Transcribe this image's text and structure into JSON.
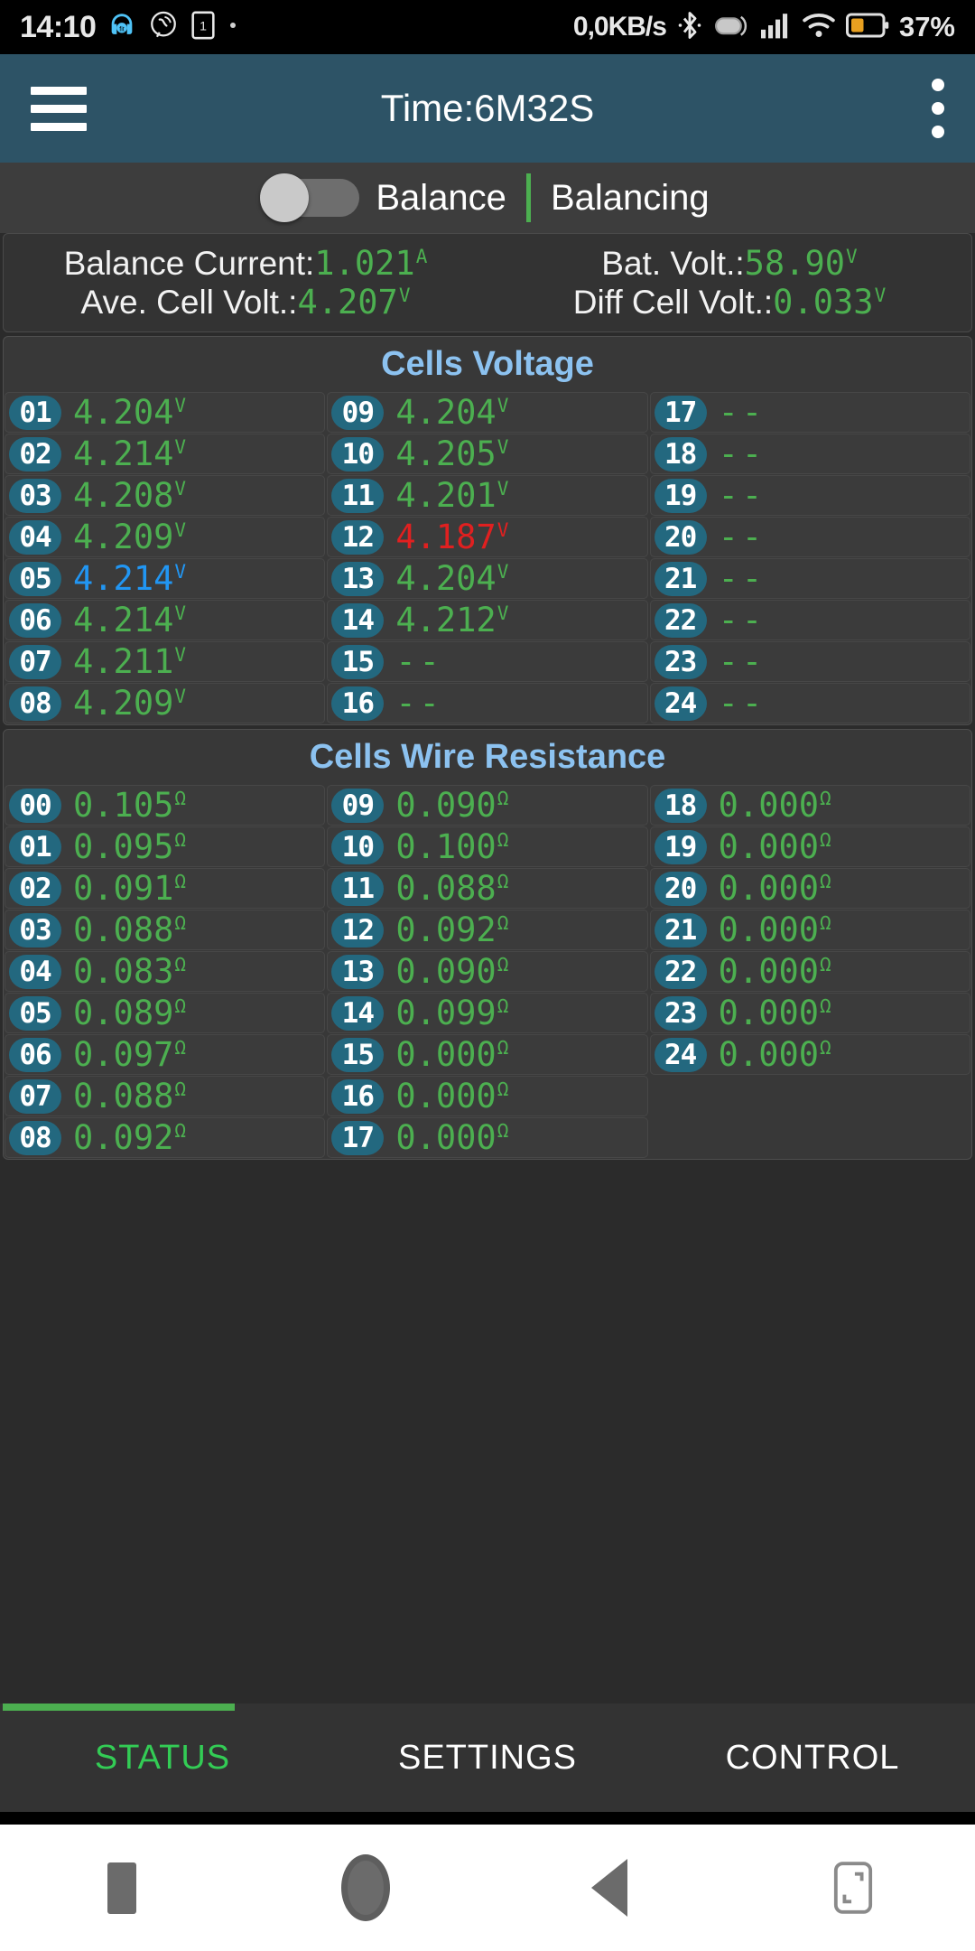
{
  "statusbar": {
    "clock": "14:10",
    "network_speed": "0,0KB/s",
    "battery_percent": "37%",
    "icons": [
      "headphones-icon",
      "viber-icon",
      "sim-card-icon",
      "dot-icon",
      "bluetooth-icon",
      "data-saver-icon",
      "signal-icon",
      "wifi-icon",
      "battery-icon"
    ]
  },
  "appbar": {
    "menu_icon": "hamburger-menu-icon",
    "title": "Time:6M32S",
    "overflow_icon": "kebab-menu-icon"
  },
  "balance_row": {
    "toggle_state": "off",
    "toggle_label": "Balance",
    "status_label": "Balancing"
  },
  "summary": {
    "balance_current": {
      "label": "Balance Current:",
      "value": "1.021",
      "unit": "A"
    },
    "bat_volt": {
      "label": "Bat. Volt.:",
      "value": "58.90",
      "unit": "V"
    },
    "ave_cell_volt": {
      "label": "Ave. Cell Volt.:",
      "value": "4.207",
      "unit": "V"
    },
    "diff_cell_volt": {
      "label": "Diff Cell Volt.:",
      "value": "0.033",
      "unit": "V"
    }
  },
  "cells_voltage": {
    "title": "Cells Voltage",
    "unit": "V",
    "na_text": "--",
    "columns": [
      [
        {
          "id": "01",
          "value": "4.204",
          "state": "normal"
        },
        {
          "id": "02",
          "value": "4.214",
          "state": "normal"
        },
        {
          "id": "03",
          "value": "4.208",
          "state": "normal"
        },
        {
          "id": "04",
          "value": "4.209",
          "state": "normal"
        },
        {
          "id": "05",
          "value": "4.214",
          "state": "high"
        },
        {
          "id": "06",
          "value": "4.214",
          "state": "normal"
        },
        {
          "id": "07",
          "value": "4.211",
          "state": "normal"
        },
        {
          "id": "08",
          "value": "4.209",
          "state": "normal"
        }
      ],
      [
        {
          "id": "09",
          "value": "4.204",
          "state": "normal"
        },
        {
          "id": "10",
          "value": "4.205",
          "state": "normal"
        },
        {
          "id": "11",
          "value": "4.201",
          "state": "normal"
        },
        {
          "id": "12",
          "value": "4.187",
          "state": "low"
        },
        {
          "id": "13",
          "value": "4.204",
          "state": "normal"
        },
        {
          "id": "14",
          "value": "4.212",
          "state": "normal"
        },
        {
          "id": "15",
          "value": "--",
          "state": "na"
        },
        {
          "id": "16",
          "value": "--",
          "state": "na"
        }
      ],
      [
        {
          "id": "17",
          "value": "--",
          "state": "na"
        },
        {
          "id": "18",
          "value": "--",
          "state": "na"
        },
        {
          "id": "19",
          "value": "--",
          "state": "na"
        },
        {
          "id": "20",
          "value": "--",
          "state": "na"
        },
        {
          "id": "21",
          "value": "--",
          "state": "na"
        },
        {
          "id": "22",
          "value": "--",
          "state": "na"
        },
        {
          "id": "23",
          "value": "--",
          "state": "na"
        },
        {
          "id": "24",
          "value": "--",
          "state": "na"
        }
      ]
    ]
  },
  "cells_wire_resistance": {
    "title": "Cells Wire Resistance",
    "unit": "Ω",
    "columns": [
      [
        {
          "id": "00",
          "value": "0.105",
          "state": "normal"
        },
        {
          "id": "01",
          "value": "0.095",
          "state": "normal"
        },
        {
          "id": "02",
          "value": "0.091",
          "state": "normal"
        },
        {
          "id": "03",
          "value": "0.088",
          "state": "normal"
        },
        {
          "id": "04",
          "value": "0.083",
          "state": "normal"
        },
        {
          "id": "05",
          "value": "0.089",
          "state": "normal"
        },
        {
          "id": "06",
          "value": "0.097",
          "state": "normal"
        },
        {
          "id": "07",
          "value": "0.088",
          "state": "normal"
        },
        {
          "id": "08",
          "value": "0.092",
          "state": "normal"
        }
      ],
      [
        {
          "id": "09",
          "value": "0.090",
          "state": "normal"
        },
        {
          "id": "10",
          "value": "0.100",
          "state": "normal"
        },
        {
          "id": "11",
          "value": "0.088",
          "state": "normal"
        },
        {
          "id": "12",
          "value": "0.092",
          "state": "normal"
        },
        {
          "id": "13",
          "value": "0.090",
          "state": "normal"
        },
        {
          "id": "14",
          "value": "0.099",
          "state": "normal"
        },
        {
          "id": "15",
          "value": "0.000",
          "state": "normal"
        },
        {
          "id": "16",
          "value": "0.000",
          "state": "normal"
        },
        {
          "id": "17",
          "value": "0.000",
          "state": "normal"
        }
      ],
      [
        {
          "id": "18",
          "value": "0.000",
          "state": "normal"
        },
        {
          "id": "19",
          "value": "0.000",
          "state": "normal"
        },
        {
          "id": "20",
          "value": "0.000",
          "state": "normal"
        },
        {
          "id": "21",
          "value": "0.000",
          "state": "normal"
        },
        {
          "id": "22",
          "value": "0.000",
          "state": "normal"
        },
        {
          "id": "23",
          "value": "0.000",
          "state": "normal"
        },
        {
          "id": "24",
          "value": "0.000",
          "state": "normal"
        }
      ]
    ]
  },
  "tabs": [
    {
      "label": "STATUS",
      "active": true
    },
    {
      "label": "SETTINGS",
      "active": false
    },
    {
      "label": "CONTROL",
      "active": false
    }
  ],
  "navbar": {
    "buttons": [
      "recents-icon",
      "home-icon",
      "back-icon",
      "split-screen-icon"
    ]
  },
  "colors": {
    "accent_green": "#4caf50",
    "appbar": "#2d5366",
    "badge": "#23687f",
    "section_title": "#8cc2f0",
    "high": "#2196f3",
    "low": "#e02020"
  }
}
